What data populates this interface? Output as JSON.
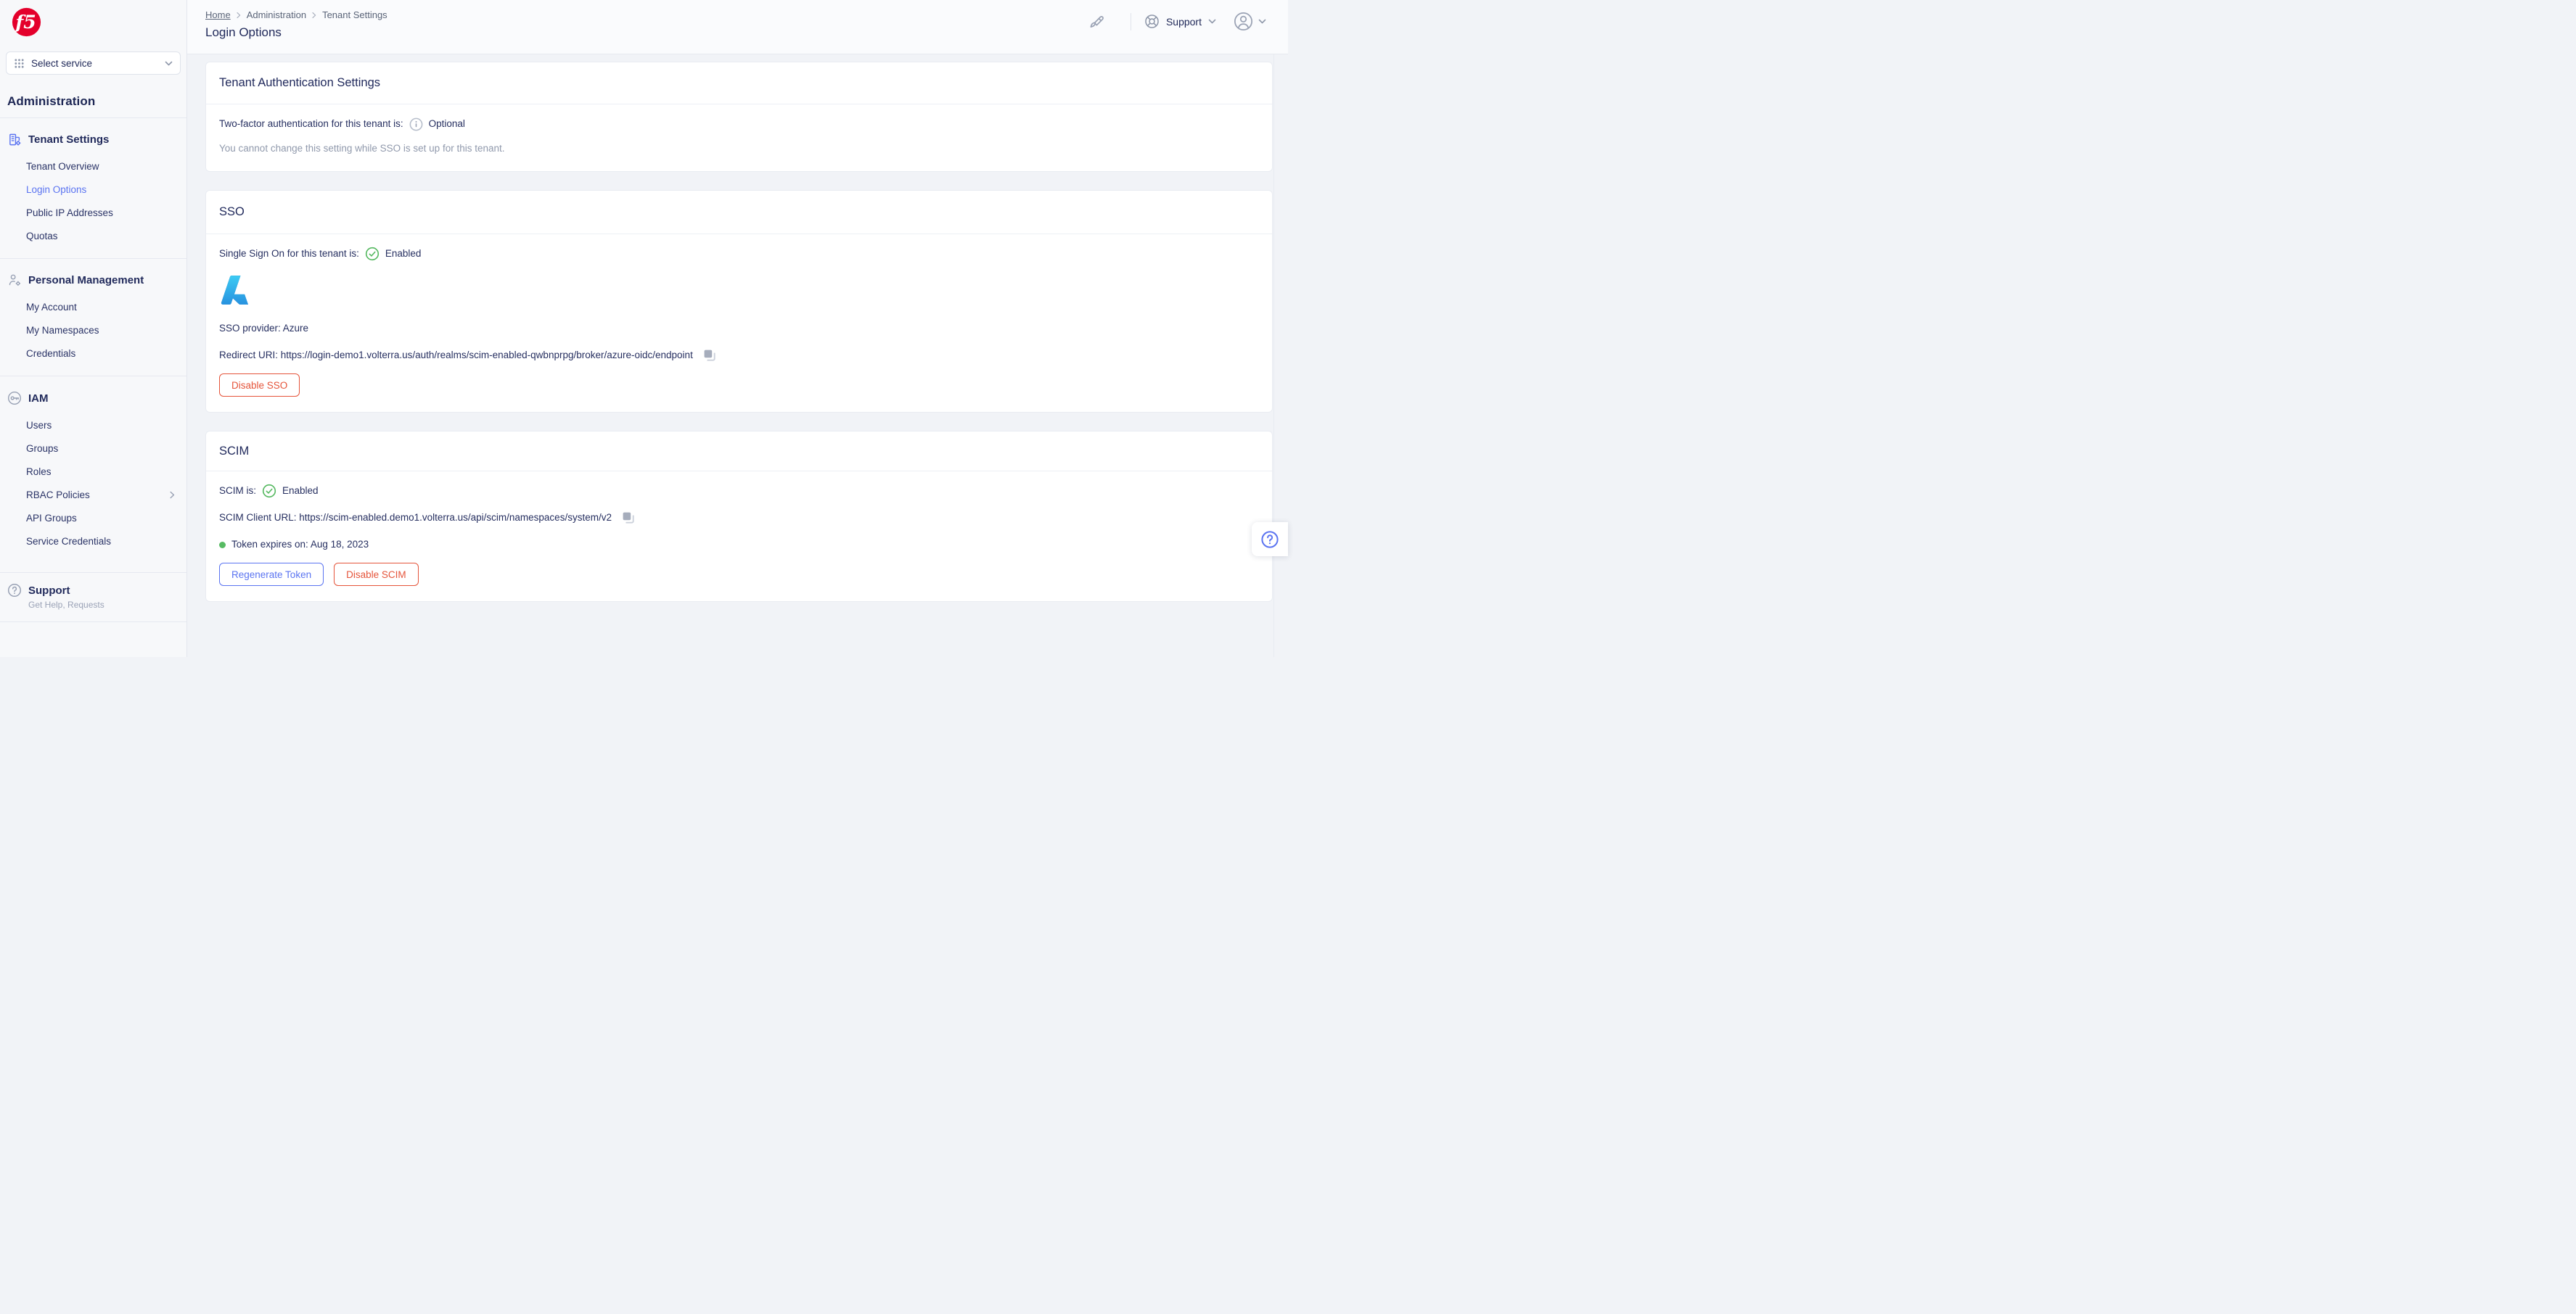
{
  "brand": {
    "logo_text": "f5"
  },
  "sidebar": {
    "service_selector": {
      "label": "Select service"
    },
    "app_title": "Administration",
    "sections": [
      {
        "label": "Tenant Settings",
        "items": [
          {
            "label": "Tenant Overview"
          },
          {
            "label": "Login Options",
            "active": true
          },
          {
            "label": "Public IP Addresses"
          },
          {
            "label": "Quotas"
          }
        ]
      },
      {
        "label": "Personal Management",
        "items": [
          {
            "label": "My Account"
          },
          {
            "label": "My Namespaces"
          },
          {
            "label": "Credentials"
          }
        ]
      },
      {
        "label": "IAM",
        "items": [
          {
            "label": "Users"
          },
          {
            "label": "Groups"
          },
          {
            "label": "Roles"
          },
          {
            "label": "RBAC Policies",
            "has_submenu": true
          },
          {
            "label": "API Groups"
          },
          {
            "label": "Service Credentials"
          }
        ]
      }
    ],
    "support": {
      "label": "Support",
      "subtitle": "Get Help, Requests"
    }
  },
  "header": {
    "breadcrumb": [
      "Home",
      "Administration",
      "Tenant Settings"
    ],
    "title": "Login Options",
    "support_label": "Support"
  },
  "cards": {
    "auth": {
      "title": "Tenant Authentication Settings",
      "two_factor_label": "Two-factor authentication for this tenant is:",
      "two_factor_value": "Optional",
      "note": "You cannot change this setting while SSO is set up for this tenant."
    },
    "sso": {
      "title": "SSO",
      "status_label": "Single Sign On for this tenant is:",
      "status_value": "Enabled",
      "provider_line": "SSO provider: Azure",
      "redirect_line": "Redirect URI: https://login-demo1.volterra.us/auth/realms/scim-enabled-qwbnprpg/broker/azure-oidc/endpoint",
      "disable_button": "Disable SSO"
    },
    "scim": {
      "title": "SCIM",
      "status_label": "SCIM is:",
      "status_value": "Enabled",
      "client_url_line": "SCIM Client URL: https://scim-enabled.demo1.volterra.us/api/scim/namespaces/system/v2",
      "token_line": "Token expires on: Aug 18, 2023",
      "regenerate_button": "Regenerate Token",
      "disable_button": "Disable SCIM"
    }
  },
  "icons": {
    "breadcrumb_separator": "chevron-right",
    "status_ok": "check-circle",
    "copy": "copy"
  },
  "colors": {
    "accent_blue": "#5b74f1",
    "danger_red": "#e5543a",
    "success_green": "#54b85f",
    "f5_red": "#e4002b",
    "navy_text": "#222b5c",
    "muted_gray": "#9099ac",
    "azure_blue_dark": "#114a8b",
    "azure_blue": "#0078d4",
    "azure_blue_light": "#3ccbf4"
  }
}
